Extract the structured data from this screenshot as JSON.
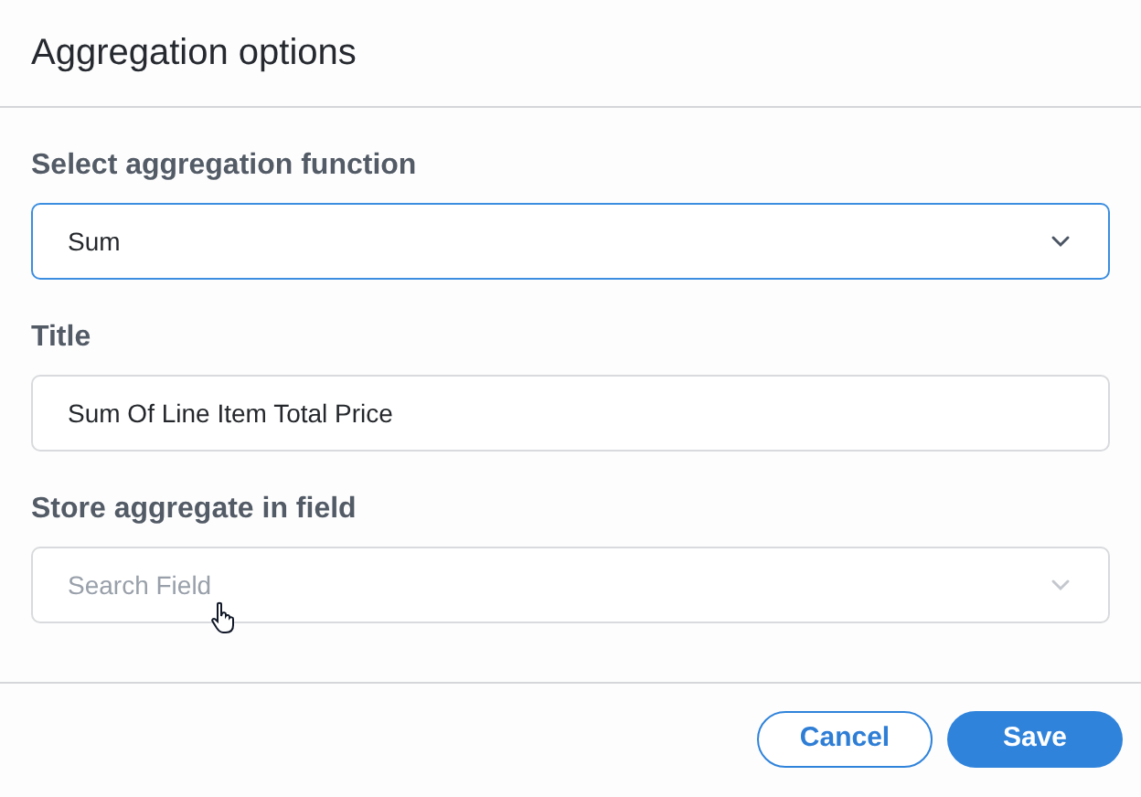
{
  "dialog": {
    "title": "Aggregation options"
  },
  "fields": [
    {
      "label": "Select aggregation function",
      "kind": "select",
      "value": "Sum",
      "focused": true
    },
    {
      "label": "Title",
      "kind": "text",
      "value": "Sum Of Line Item Total Price",
      "focused": false
    },
    {
      "label": "Store aggregate in field",
      "kind": "select",
      "placeholder": "Search Field",
      "focused": false
    }
  ],
  "buttons": [
    {
      "label": "Cancel",
      "kind": "secondary"
    },
    {
      "label": "Save",
      "kind": "primary"
    }
  ]
}
